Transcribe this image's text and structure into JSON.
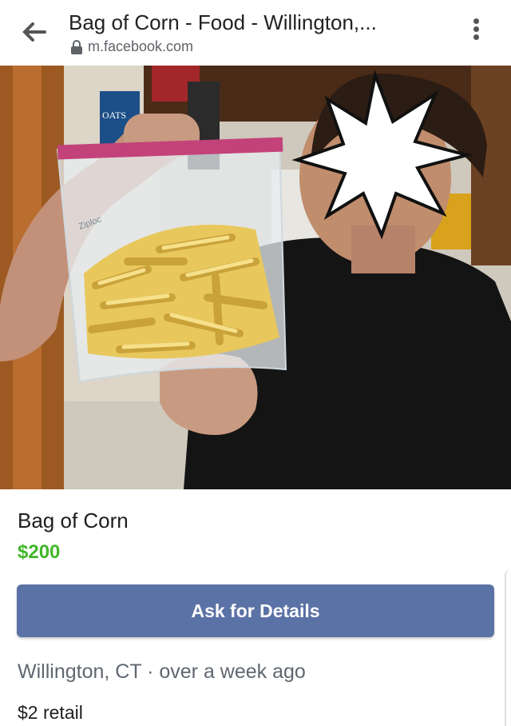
{
  "header": {
    "title": "Bag of Corn - Food - Willington,...",
    "url": "m.facebook.com",
    "back_icon": "arrow-left-icon",
    "menu_icon": "more-vertical-icon"
  },
  "listing": {
    "title": "Bag of Corn",
    "price": "$200",
    "action_label": "Ask for Details",
    "location": "Willington, CT",
    "time": "over a week ago",
    "note": "$2 retail",
    "price_color": "#42b72a",
    "button_color": "#5b72a6"
  },
  "photo": {
    "description_labels": [
      "OATS",
      "Ziploc"
    ]
  }
}
